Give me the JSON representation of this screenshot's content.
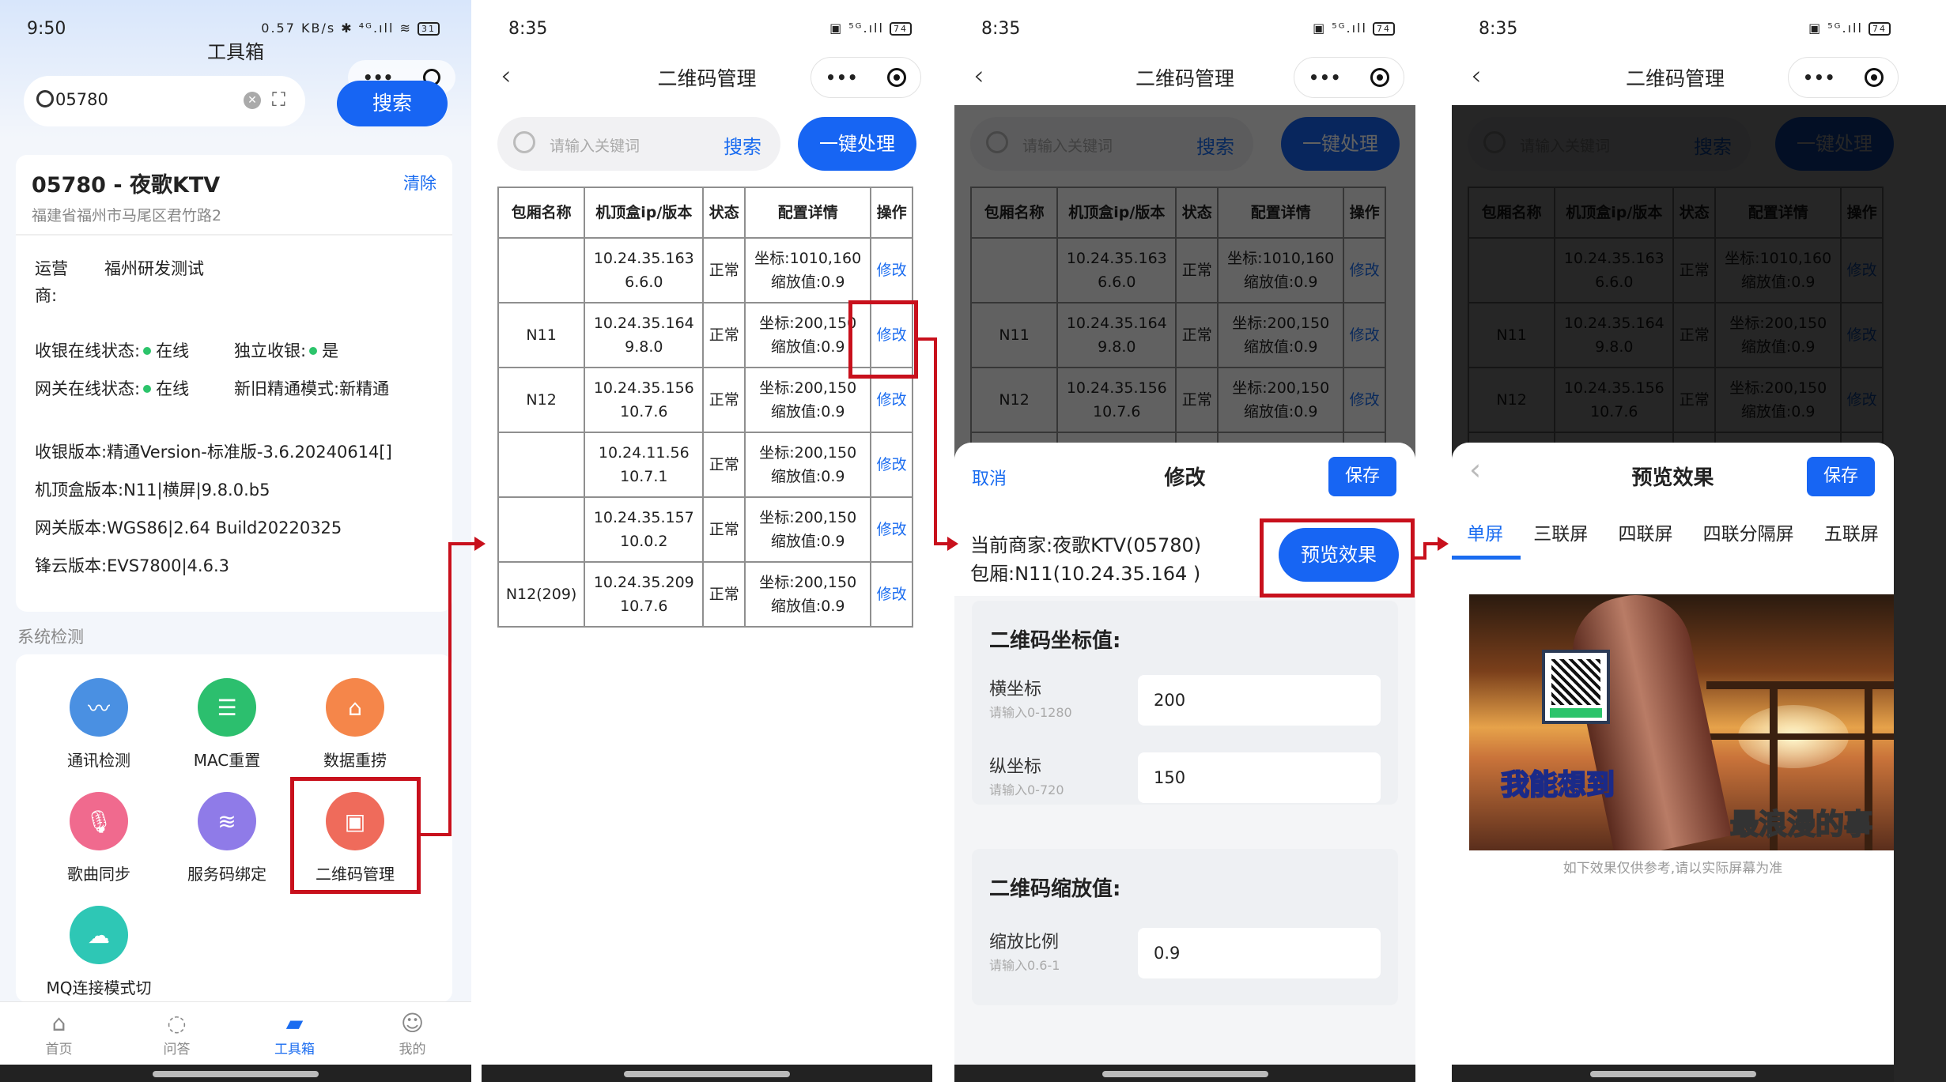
{
  "screen1": {
    "time": "9:50",
    "status_icons": "0.57 KB/s ✱ ⁴ᴳ.ıll ≋",
    "battery": "31",
    "title": "工具箱",
    "search_value": "05780",
    "search_button": "搜索",
    "merchant_title": "05780 - 夜歌KTV",
    "clear_label": "清除",
    "address": "福建省福州市马尾区君竹路2",
    "operator_label": "运营",
    "operator_label2": "商:",
    "operator_value": "福州研发测试",
    "cashier_online_label": "收银在线状态:",
    "cashier_online_value": "在线",
    "independent_label": "独立收银:",
    "independent_value": "是",
    "gateway_online_label": "网关在线状态:",
    "gateway_online_value": "在线",
    "mode_label": "新旧精通模式:",
    "mode_value": "新精通",
    "cashier_version": "收银版本:精通Version-标准版-3.6.20240614[]",
    "stb_version": "机顶盒版本:N11|横屏|9.8.0.b5",
    "gateway_version": "网关版本:WGS86|2.64 Build20220325",
    "fengyun_version": "锋云版本:EVS7800|4.6.3",
    "section_title": "系统检测",
    "tools": [
      {
        "label": "通讯检测",
        "icon": "monitor-icon",
        "color": "#4a90e2"
      },
      {
        "label": "MAC重置",
        "icon": "reset-icon",
        "color": "#2cbf6e"
      },
      {
        "label": "数据重捞",
        "icon": "data-icon",
        "color": "#f5864a"
      },
      {
        "label": "歌曲同步",
        "icon": "mic-icon",
        "color": "#f06a8e"
      },
      {
        "label": "服务码绑定",
        "icon": "bind-icon",
        "color": "#8f7be8"
      },
      {
        "label": "二维码管理",
        "icon": "qrcode-icon",
        "color": "#ef6b5b"
      },
      {
        "label": "MQ连接模式切",
        "icon": "cloud-icon",
        "color": "#2ec7b5"
      }
    ],
    "tabbar": [
      "首页",
      "问答",
      "工具箱",
      "我的"
    ]
  },
  "screen2": {
    "time": "8:35",
    "status_icons": "▣ ⁵ᴳ.ıll",
    "battery": "74",
    "title": "二维码管理",
    "search_placeholder": "请输入关键词",
    "search_button": "搜索",
    "one_key_button": "一键处理",
    "columns": [
      "包厢名称",
      "机顶盒ip/版本",
      "状态",
      "配置详情",
      "操作"
    ],
    "rows": [
      {
        "room": "",
        "ip": "10.24.35.163",
        "ver": "6.6.0",
        "status": "正常",
        "coord": "坐标:1010,160",
        "scale": "缩放值:0.9",
        "op": "修改"
      },
      {
        "room": "N11",
        "ip": "10.24.35.164",
        "ver": "9.8.0",
        "status": "正常",
        "coord": "坐标:200,150",
        "scale": "缩放值:0.9",
        "op": "修改"
      },
      {
        "room": "N12",
        "ip": "10.24.35.156",
        "ver": "10.7.6",
        "status": "正常",
        "coord": "坐标:200,150",
        "scale": "缩放值:0.9",
        "op": "修改"
      },
      {
        "room": "",
        "ip": "10.24.11.56",
        "ver": "10.7.1",
        "status": "正常",
        "coord": "坐标:200,150",
        "scale": "缩放值:0.9",
        "op": "修改"
      },
      {
        "room": "",
        "ip": "10.24.35.157",
        "ver": "10.0.2",
        "status": "正常",
        "coord": "坐标:200,150",
        "scale": "缩放值:0.9",
        "op": "修改"
      },
      {
        "room": "N12(209)",
        "ip": "10.24.35.209",
        "ver": "10.7.6",
        "status": "正常",
        "coord": "坐标:200,150",
        "scale": "缩放值:0.9",
        "op": "修改"
      }
    ]
  },
  "screen3": {
    "cancel": "取消",
    "sheet_title": "修改",
    "save": "保存",
    "current_merchant": "当前商家:夜歌KTV(05780)",
    "room": "包厢:N11(10.24.35.164 )",
    "preview_button": "预览效果",
    "coord_block_title": "二维码坐标值:",
    "x_label": "横坐标",
    "x_hint": "请输入0-1280",
    "x_value": "200",
    "y_label": "纵坐标",
    "y_hint": "请输入0-720",
    "y_value": "150",
    "scale_block_title": "二维码缩放值:",
    "scale_label": "缩放比例",
    "scale_hint": "请输入0.6-1",
    "scale_value": "0.9"
  },
  "screen4": {
    "sheet_title": "预览效果",
    "save": "保存",
    "tabs": [
      "单屏",
      "三联屏",
      "四联屏",
      "四联分隔屏",
      "五联屏"
    ],
    "lyric1": "我能想到",
    "lyric2": "最浪漫的事",
    "note": "如下效果仅供参考,请以实际屏幕为准"
  }
}
